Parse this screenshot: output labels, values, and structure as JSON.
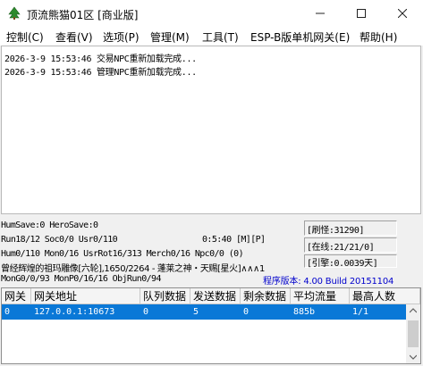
{
  "window": {
    "title": "顶流熊猫01区 [商业版]",
    "controls": [
      "minimize-icon",
      "maximize-icon",
      "close-icon"
    ]
  },
  "menu": [
    "控制(C)",
    "查看(V)",
    "选项(P)",
    "管理(M)",
    "工具(T)",
    "ESP-B版单机网关(E)",
    "帮助(H)"
  ],
  "log": [
    "2026-3-9 15:53:46 交易NPC重新加载完成...",
    "2026-3-9 15:53:46 管理NPC重新加载完成..."
  ],
  "status": {
    "line1": "HumSave:0 HeroSave:0",
    "line2": "Run18/12 Soc0/0 Usr0/110",
    "time": "0:5:40 [M][P]",
    "line3": "Hum0/110 Mon0/16 UsrRot16/313 Merch0/16 Npc0/0 (0)",
    "line4": "曾经辉煌的祖玛雕像[六轮],1650/2264 - 蓬莱之神・天赐[星火]∧∧∧1",
    "line5": "MonG0/0/93 MonP0/16/16 ObjRun0/94",
    "refresh": "[刷怪:31290]",
    "online": "[在线:21/21/0]",
    "engine": "[引擎:0.0039天]",
    "version": "程序版本: 4.00 Build 20151104"
  },
  "table": {
    "columns": [
      "网关",
      "网关地址",
      "队列数据",
      "发送数据",
      "剩余数据",
      "平均流量",
      "最高人数"
    ],
    "rows": [
      [
        "0",
        "127.0.0.1:10673",
        "0",
        "5",
        "0",
        "885b",
        "1/1"
      ]
    ]
  },
  "colors": {
    "selection": "#0a78d7",
    "version_text": "#0000cc"
  }
}
